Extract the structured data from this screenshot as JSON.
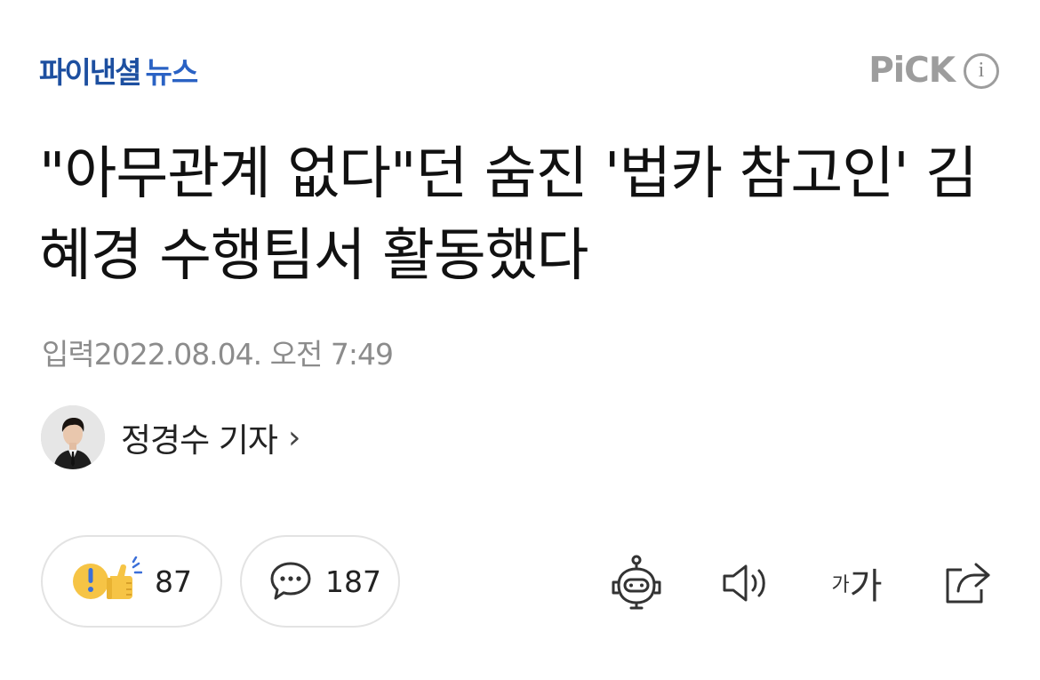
{
  "header": {
    "press_name": "파이낸셜",
    "press_name_sub": "뉴스",
    "pick_label": "PiCK",
    "info_icon_glyph": "i"
  },
  "article": {
    "headline": "\"아무관계 없다\"던 숨진 '법카 참고인' 김혜경 수행팀서 활동했다",
    "published": "입력2022.08.04. 오전 7:49"
  },
  "reporter": {
    "name": "정경수 기자",
    "chevron": "›"
  },
  "actions": {
    "reaction_count": "87",
    "comment_count": "187",
    "font_size_small": "가",
    "font_size_big": "가"
  },
  "icons": {
    "reaction": "surprise-like-icon",
    "comment": "speech-bubble-icon",
    "summary_bot": "robot-icon",
    "tts": "speaker-icon",
    "font_size": "font-size-icon",
    "share": "share-icon",
    "info": "info-icon"
  },
  "colors": {
    "brand_blue": "#1d4fa0",
    "pick_gray": "#9d9d9d",
    "meta_gray": "#8c8c8c",
    "reaction_yellow": "#f6c445",
    "reaction_blue": "#3b6fd8"
  }
}
